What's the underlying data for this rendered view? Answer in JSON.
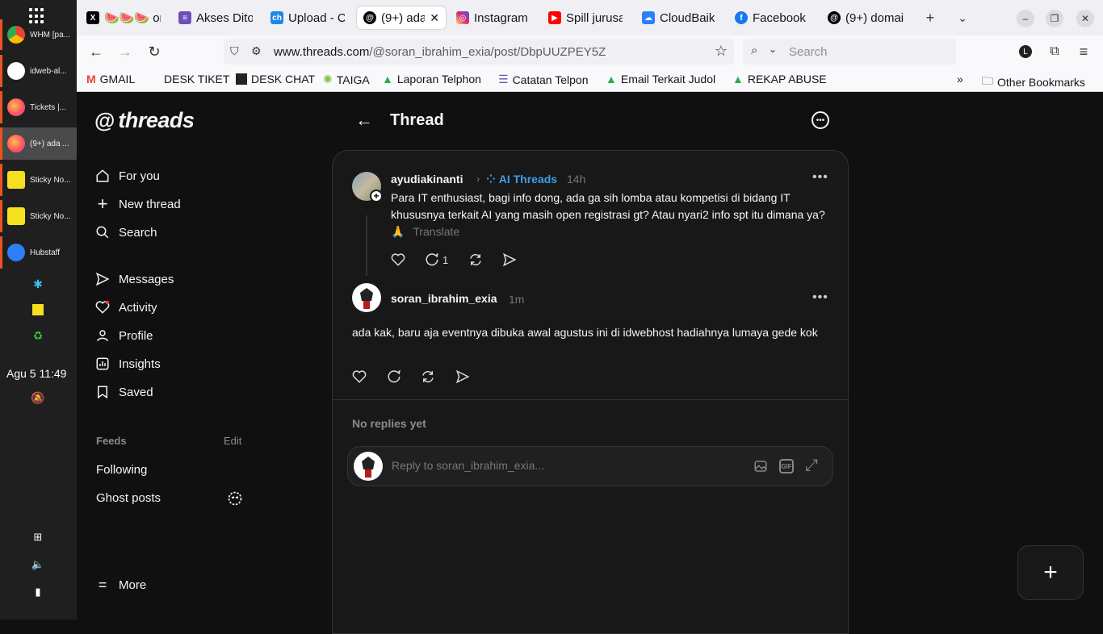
{
  "os": {
    "dock_items": [
      {
        "label": "WHM [pa...",
        "color": "#4285f4"
      },
      {
        "label": "idweb-al...",
        "color": "#36c5f0"
      },
      {
        "label": "Tickets |...",
        "color": "#ff7139"
      },
      {
        "label": "(9+) ada ...",
        "color": "#ff7139"
      },
      {
        "label": "Sticky No...",
        "color": "#f5e020"
      },
      {
        "label": "Sticky No...",
        "color": "#f5e020"
      },
      {
        "label": "Hubstaff",
        "color": "#2d7ff9"
      }
    ],
    "clock": "Agu 5  11:49"
  },
  "browser": {
    "tabs": [
      {
        "title": "🍉🍉🍉 on",
        "fav": "X",
        "fav_color": "#000000"
      },
      {
        "title": "Akses Dito",
        "fav": "≡",
        "fav_color": "#6b4fbb"
      },
      {
        "title": "Upload - Ch",
        "fav": "ch",
        "fav_color": "#1e88e5"
      },
      {
        "title": "(9+) ada",
        "fav": "@",
        "fav_color": "#000000"
      },
      {
        "title": "Instagram",
        "fav": "◎",
        "fav_color": "#e1306c"
      },
      {
        "title": "Spill jurusa",
        "fav": "▶",
        "fav_color": "#ff0000"
      },
      {
        "title": "CloudBaik",
        "fav": "☁",
        "fav_color": "#2d7ff9"
      },
      {
        "title": "Facebook",
        "fav": "f",
        "fav_color": "#1877f2"
      },
      {
        "title": "(9+) domai",
        "fav": "@",
        "fav_color": "#000000"
      }
    ],
    "url_domain": "www.threads.com",
    "url_path": "/@soran_ibrahim_exia/post/DbpUUZPEY5Z",
    "search_placeholder": "Search",
    "bookmarks": [
      {
        "label": "GMAIL",
        "color": "#ea4335"
      },
      {
        "label": "DESK TIKET",
        "color": ""
      },
      {
        "label": "DESK CHAT",
        "color": "#222222"
      },
      {
        "label": "TAIGA",
        "color": "#83c341"
      },
      {
        "label": "Laporan Telphon",
        "color": "#34a853"
      },
      {
        "label": "Catatan Telpon",
        "color": "#6b4fbb"
      },
      {
        "label": "Email Terkait Judol",
        "color": "#34a853"
      },
      {
        "label": "REKAP ABUSE",
        "color": "#34a853"
      }
    ],
    "other_bookmarks": "Other Bookmarks"
  },
  "threads": {
    "logo_text": "threads",
    "nav": {
      "for_you": "For you",
      "new_thread": "New thread",
      "search": "Search",
      "messages": "Messages",
      "activity": "Activity",
      "profile": "Profile",
      "insights": "Insights",
      "saved": "Saved"
    },
    "feeds": {
      "heading": "Feeds",
      "edit": "Edit",
      "following": "Following",
      "ghost_posts": "Ghost posts"
    },
    "more": "More",
    "header_title": "Thread",
    "post": {
      "username": "ayudiakinanti",
      "topic": "AI Threads",
      "time": "14h",
      "text": "Para IT enthusiast, bagi info dong, ada ga sih lomba atau kompetisi di bidang IT khususnya terkait AI yang masih open registrasi gt? Atau nyari2 info spt itu dimana ya? 🙏",
      "translate": "Translate",
      "reply_count": "1"
    },
    "reply": {
      "username": "soran_ibrahim_exia",
      "time": "1m",
      "text": "ada kak, baru aja eventnya dibuka awal agustus ini di idwebhost hadiahnya lumaya gede kok"
    },
    "no_replies": "No replies yet",
    "reply_placeholder": "Reply to soran_ibrahim_exia..."
  }
}
